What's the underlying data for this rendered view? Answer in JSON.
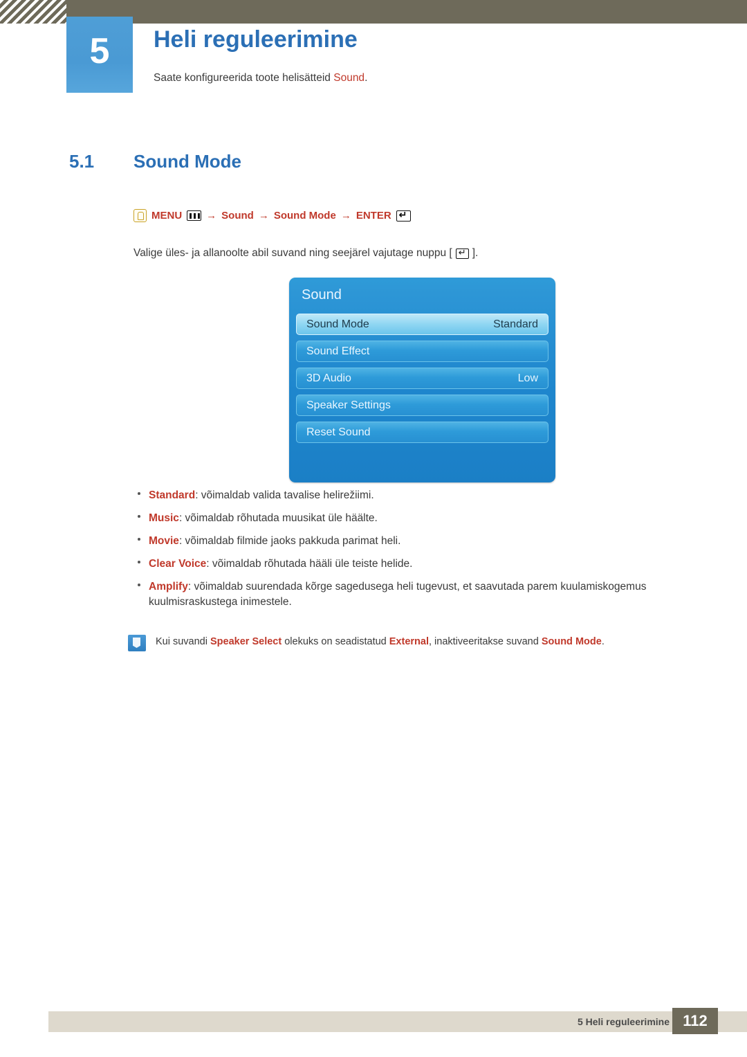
{
  "header": {
    "chapter_number": "5",
    "chapter_title": "Heli reguleerimine",
    "chapter_subtitle_before": "Saate konfigureerida toote helisätteid ",
    "chapter_subtitle_kw": "Sound",
    "chapter_subtitle_after": "."
  },
  "section": {
    "number": "5.1",
    "title": "Sound Mode"
  },
  "path": {
    "hand_icon": "hand-pointer-icon",
    "menu_label": "MENU",
    "menu_icon": "menu-bars-icon",
    "arrow": "→",
    "item1": "Sound",
    "item2": "Sound Mode",
    "enter_label": "ENTER",
    "enter_icon": "enter-key-icon"
  },
  "instruction": {
    "before": "Valige üles- ja allanoolte abil suvand ning seejärel vajutage nuppu [",
    "enter_icon": "enter-key-icon",
    "after": "]."
  },
  "osd": {
    "title": "Sound",
    "rows": [
      {
        "label": "Sound Mode",
        "value": "Standard",
        "selected": true
      },
      {
        "label": "Sound Effect",
        "value": "",
        "selected": false
      },
      {
        "label": "3D Audio",
        "value": "Low",
        "selected": false
      },
      {
        "label": "Speaker Settings",
        "value": "",
        "selected": false
      },
      {
        "label": "Reset Sound",
        "value": "",
        "selected": false
      }
    ]
  },
  "bullets": [
    {
      "kw": "Standard",
      "text": ": võimaldab valida tavalise helirežiimi."
    },
    {
      "kw": "Music",
      "text": ": võimaldab rõhutada muusikat üle häälte."
    },
    {
      "kw": "Movie",
      "text": ": võimaldab filmide jaoks pakkuda parimat heli."
    },
    {
      "kw": "Clear Voice",
      "text": ": võimaldab rõhutada hääli üle teiste helide."
    },
    {
      "kw": "Amplify",
      "text": ": võimaldab suurendada kõrge sagedusega heli tugevust, et saavutada parem kuulamiskogemus kuulmisraskustega inimestele."
    }
  ],
  "note": {
    "icon": "note-info-icon",
    "part1": "Kui suvandi ",
    "kw1": "Speaker Select",
    "part2": " olekuks on seadistatud ",
    "kw2": "External",
    "part3": ", inaktiveeritakse suvand ",
    "kw3": "Sound Mode",
    "part4": "."
  },
  "footer": {
    "text": "5 Heli reguleerimine",
    "page": "112"
  },
  "colors": {
    "accent_blue": "#2b6fb5",
    "keyword_red": "#c0392b",
    "header_bar": "#6e6a5a",
    "footer_bar": "#ded9cd",
    "osd_blue": "#1e86cd"
  }
}
